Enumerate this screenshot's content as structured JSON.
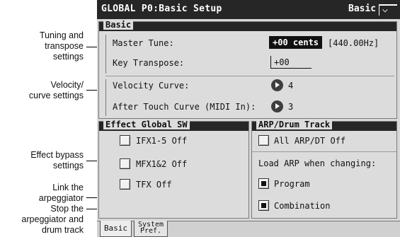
{
  "annotations": {
    "tuning": [
      "Tuning and",
      "transpose",
      "settings"
    ],
    "velocity": [
      "Velocity/",
      "curve settings"
    ],
    "effect": [
      "Effect bypass",
      "settings"
    ],
    "link": [
      "Link the",
      "arpeggiator"
    ],
    "stop": [
      "Stop the",
      "arpeggiator and",
      "drum track"
    ]
  },
  "titlebar": {
    "title": "GLOBAL P0:Basic Setup",
    "page": "Basic",
    "menu_icon": "chevron-down-icon"
  },
  "basic": {
    "header": "Basic",
    "master_tune_label": "Master Tune:",
    "master_tune_value": "+00 cents",
    "master_tune_hz": "[440.00Hz]",
    "key_transpose_label": "Key Transpose:",
    "key_transpose_value": "+00",
    "velocity_curve_label": "Velocity Curve:",
    "velocity_curve_value": "4",
    "after_touch_label": "After Touch Curve (MIDI In):",
    "after_touch_value": "3"
  },
  "effect": {
    "header": "Effect Global SW",
    "ifx": "IFX1-5 Off",
    "mfx": "MFX1&2 Off",
    "tfx": "TFX Off"
  },
  "arp": {
    "header": "ARP/Drum Track",
    "all_off": "All ARP/DT Off",
    "load_label": "Load ARP when changing:",
    "program": "Program",
    "combination": "Combination"
  },
  "tabs": {
    "basic": "Basic",
    "system_line1": "System",
    "system_line2": "Pref."
  }
}
